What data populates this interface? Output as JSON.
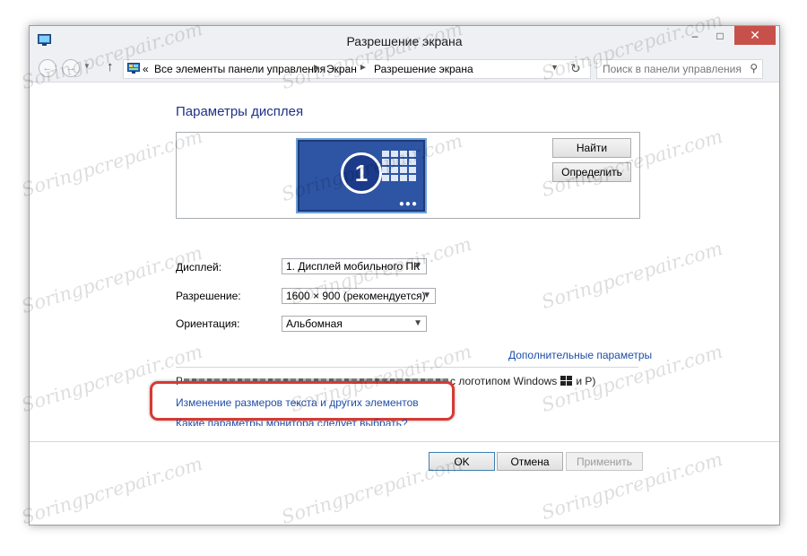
{
  "window": {
    "title": "Разрешение экрана",
    "close_glyph": "✕",
    "minimize_glyph": "–",
    "maximize_glyph": "□"
  },
  "navbar": {
    "breadcrumb_prefix": "«",
    "breadcrumb": [
      "Все элементы панели управления",
      "Экран",
      "Разрешение экрана"
    ],
    "search_placeholder": "Поиск в панели управления"
  },
  "content": {
    "heading": "Параметры дисплея",
    "monitor_number": "1",
    "find_button": "Найти",
    "identify_button": "Определить",
    "display_label": "Дисплей:",
    "display_value": "1. Дисплей мобильного ПК",
    "resolution_label": "Разрешение:",
    "resolution_value": "1600 × 900 (рекомендуется)",
    "orientation_label": "Ориентация:",
    "orientation_value": "Альбомная",
    "advanced_link": "Дополнительные параметры",
    "projector_tail_before": "с логотипом Windows",
    "projector_tail_after": "и P)",
    "resize_link": "Изменение размеров текста и других элементов",
    "monitor_help_link": "Какие параметры монитора следует выбрать?"
  },
  "buttons": {
    "ok": "OK",
    "cancel": "Отмена",
    "apply": "Применить"
  },
  "watermark": "Soringpcrepair.com",
  "colors": {
    "link": "#1f4ea8",
    "heading": "#1e3287",
    "close_button": "#c7514a",
    "highlight": "#d63a32",
    "monitor": "#2e54a4"
  }
}
